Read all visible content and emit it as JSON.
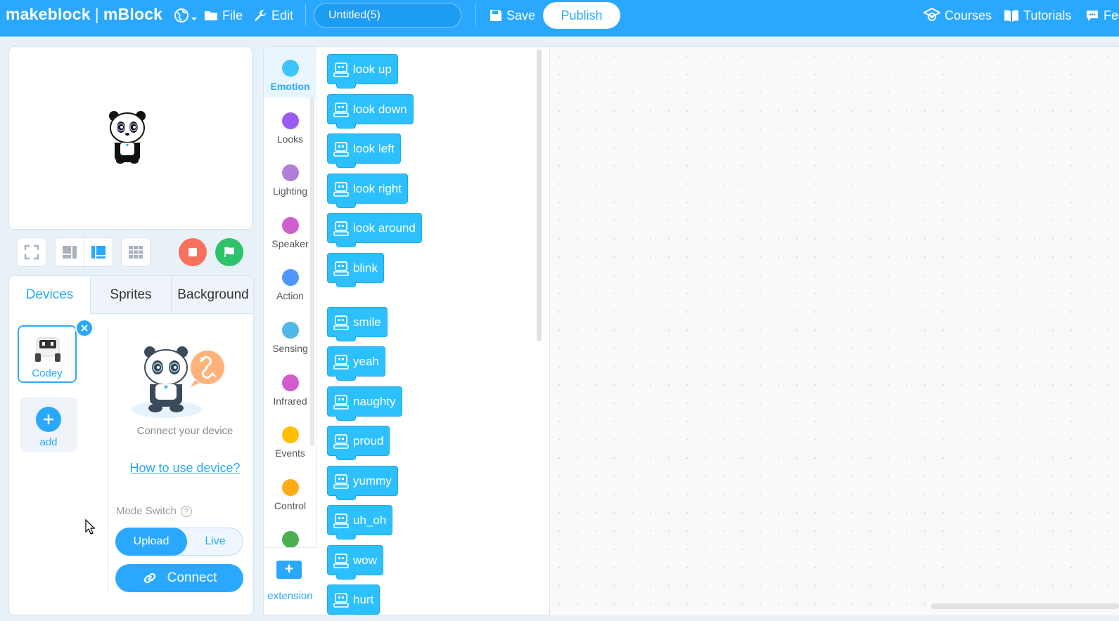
{
  "header": {
    "brand": "makeblock",
    "brand_sep": "|",
    "app_name": "mBlock",
    "file": "File",
    "edit": "Edit",
    "project_title": "Untitled(5)",
    "save": "Save",
    "publish": "Publish",
    "courses": "Courses",
    "tutorials": "Tutorials",
    "feedback": "Feed"
  },
  "device_panel": {
    "tabs": [
      "Devices",
      "Sprites",
      "Background"
    ],
    "device_name": "Codey",
    "add_label": "add",
    "connect_text": "Connect your device",
    "howto_link": "How to use device?",
    "mode_label": "Mode Switch",
    "help_glyph": "?",
    "mode_options": [
      "Upload",
      "Live"
    ],
    "connect_button": "Connect"
  },
  "categories": [
    {
      "label": "Emotion",
      "color": "#3ec4ff"
    },
    {
      "label": "Looks",
      "color": "#9a5cf0"
    },
    {
      "label": "Lighting",
      "color": "#b07fd8"
    },
    {
      "label": "Speaker",
      "color": "#cf5fce"
    },
    {
      "label": "Action",
      "color": "#4d97ff"
    },
    {
      "label": "Sensing",
      "color": "#4fb9e6"
    },
    {
      "label": "Infrared",
      "color": "#d45bcd"
    },
    {
      "label": "Events",
      "color": "#ffbf00"
    },
    {
      "label": "Control",
      "color": "#ffab19"
    },
    {
      "label": "",
      "color": "#4caf50"
    }
  ],
  "extension_label": "extension",
  "blocks": [
    "look up",
    "look down",
    "look left",
    "look right",
    "look around",
    "blink",
    "smile",
    "yeah",
    "naughty",
    "proud",
    "yummy",
    "uh_oh",
    "wow",
    "hurt"
  ],
  "colors": {
    "accent": "#2aa8ff",
    "block": "#2dc0ff",
    "stop": "#f7715c",
    "go": "#2ec26a"
  }
}
